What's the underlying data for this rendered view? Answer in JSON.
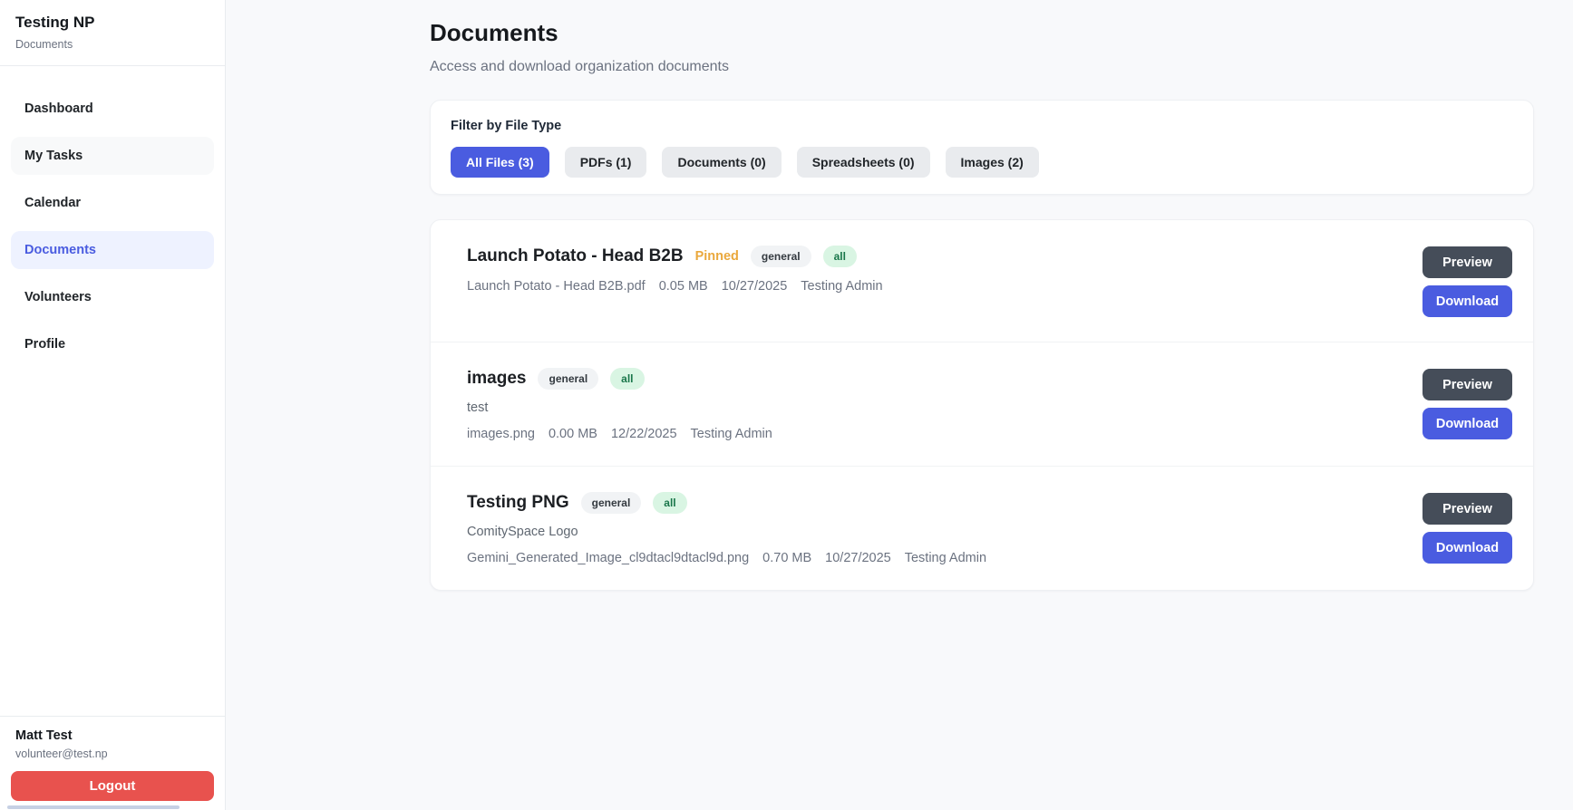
{
  "sidebar": {
    "org_name": "Testing NP",
    "org_subtitle": "Documents",
    "items": [
      {
        "label": "Dashboard",
        "active": false
      },
      {
        "label": "My Tasks",
        "active": false
      },
      {
        "label": "Calendar",
        "active": false
      },
      {
        "label": "Documents",
        "active": true
      },
      {
        "label": "Volunteers",
        "active": false
      },
      {
        "label": "Profile",
        "active": false
      }
    ],
    "user": {
      "name": "Matt Test",
      "email": "volunteer@test.np"
    },
    "logout_label": "Logout"
  },
  "header": {
    "title": "Documents",
    "subtitle": "Access and download organization documents"
  },
  "filter": {
    "label": "Filter by File Type",
    "options": [
      {
        "label": "All Files (3)",
        "active": true
      },
      {
        "label": "PDFs (1)",
        "active": false
      },
      {
        "label": "Documents (0)",
        "active": false
      },
      {
        "label": "Spreadsheets (0)",
        "active": false
      },
      {
        "label": "Images (2)",
        "active": false
      }
    ]
  },
  "actions": {
    "preview": "Preview",
    "download": "Download"
  },
  "documents": [
    {
      "title": "Launch Potato - Head B2B",
      "pinned": "Pinned",
      "badges": [
        "general",
        "all"
      ],
      "description": "",
      "file_name": "Launch Potato - Head B2B.pdf",
      "size": "0.05 MB",
      "date": "10/27/2025",
      "uploader": "Testing Admin"
    },
    {
      "title": "images",
      "pinned": "",
      "badges": [
        "general",
        "all"
      ],
      "description": "test",
      "file_name": "images.png",
      "size": "0.00 MB",
      "date": "12/22/2025",
      "uploader": "Testing Admin"
    },
    {
      "title": "Testing PNG",
      "pinned": "",
      "badges": [
        "general",
        "all"
      ],
      "description": "ComitySpace Logo",
      "file_name": "Gemini_Generated_Image_cl9dtacl9dtacl9d.png",
      "size": "0.70 MB",
      "date": "10/27/2025",
      "uploader": "Testing Admin"
    }
  ],
  "colors": {
    "accent": "#4a5ce0",
    "accent_light": "#eef2ff",
    "preview": "#454d59",
    "logout": "#e8524e",
    "pinned": "#eaa83c",
    "badge_green_bg": "#d9f5e3",
    "badge_green_text": "#19764a",
    "badge_gray_bg": "#f1f3f5",
    "page_bg": "#f8f9fb"
  }
}
